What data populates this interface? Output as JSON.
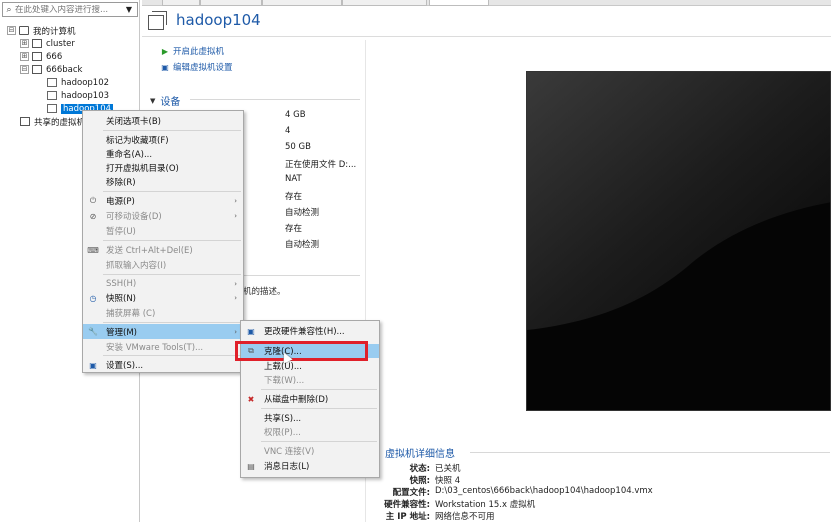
{
  "library": {
    "search_placeholder": "在此处键入内容进行搜...",
    "items": [
      {
        "label": "我的计算机",
        "expander": "⊟"
      },
      {
        "label": "cluster",
        "expander": "⊞"
      },
      {
        "label": "666",
        "expander": "⊞"
      },
      {
        "label": "666back",
        "expander": "⊟"
      },
      {
        "label": "hadoop102"
      },
      {
        "label": "hadoop103"
      },
      {
        "label": "hadoop104",
        "selected": true
      },
      {
        "label": "共享的虚拟机"
      }
    ]
  },
  "vm": {
    "title": "hadoop104",
    "actions": [
      "开启此虚拟机",
      "编辑虚拟机设置"
    ],
    "devices_header": "设备",
    "device_values": [
      "4 GB",
      "4",
      "50 GB",
      "正在使用文件 D:...",
      "NAT",
      "存在",
      "自动检测",
      "存在",
      "自动检测"
    ],
    "description": "机的描述。"
  },
  "details": {
    "title": "虚拟机详细信息",
    "rows": [
      {
        "key": "状态:",
        "value": "已关机"
      },
      {
        "key": "快照:",
        "value": "快照 4"
      },
      {
        "key": "配置文件:",
        "value": "D:\\03_centos\\666back\\hadoop104\\hadoop104.vmx"
      },
      {
        "key": "硬件兼容性:",
        "value": "Workstation 15.x 虚拟机"
      },
      {
        "key": "主 IP 地址:",
        "value": "网络信息不可用"
      }
    ]
  },
  "context_menu": {
    "items": [
      {
        "label": "关闭选项卡(B)"
      },
      {
        "label": "标记为收藏项(F)"
      },
      {
        "label": "重命名(A)..."
      },
      {
        "label": "打开虚拟机目录(O)"
      },
      {
        "label": "移除(R)"
      },
      {
        "label": "电源(P)",
        "icon": "power-icon",
        "submenu": true
      },
      {
        "label": "可移动设备(D)",
        "icon": "removable-devices-icon",
        "submenu": true,
        "disabled": true
      },
      {
        "label": "暂停(U)",
        "disabled": true
      },
      {
        "label": "发送 Ctrl+Alt+Del(E)",
        "icon": "keyboard-icon",
        "disabled": true
      },
      {
        "label": "抓取输入内容(I)",
        "disabled": true
      },
      {
        "label": "SSH(H)",
        "submenu": true,
        "disabled": true
      },
      {
        "label": "快照(N)",
        "icon": "snapshot-icon",
        "submenu": true
      },
      {
        "label": "捕获屏幕 (C)",
        "disabled": true
      },
      {
        "label": "管理(M)",
        "icon": "wrench-icon",
        "submenu": true,
        "highlighted": true
      },
      {
        "label": "安装 VMware Tools(T)...",
        "disabled": true
      },
      {
        "label": "设置(S)...",
        "icon": "settings-icon"
      }
    ]
  },
  "submenu": {
    "items": [
      {
        "label": "更改硬件兼容性(H)...",
        "icon": "hardware-compat-icon"
      },
      {
        "label": "克隆(C)...",
        "icon": "clone-icon",
        "highlighted": true
      },
      {
        "label": "上载(U)..."
      },
      {
        "label": "下载(W)...",
        "disabled": true
      },
      {
        "label": "从磁盘中删除(D)",
        "icon": "delete-icon"
      },
      {
        "label": "共享(S)..."
      },
      {
        "label": "权限(P)...",
        "disabled": true
      },
      {
        "label": "VNC 连接(V)",
        "disabled": true
      },
      {
        "label": "消息日志(L)",
        "icon": "log-icon"
      }
    ]
  },
  "colors": {
    "accent": "#1e5aa8",
    "highlight": "#99ccf0",
    "callout": "#e0202a"
  }
}
